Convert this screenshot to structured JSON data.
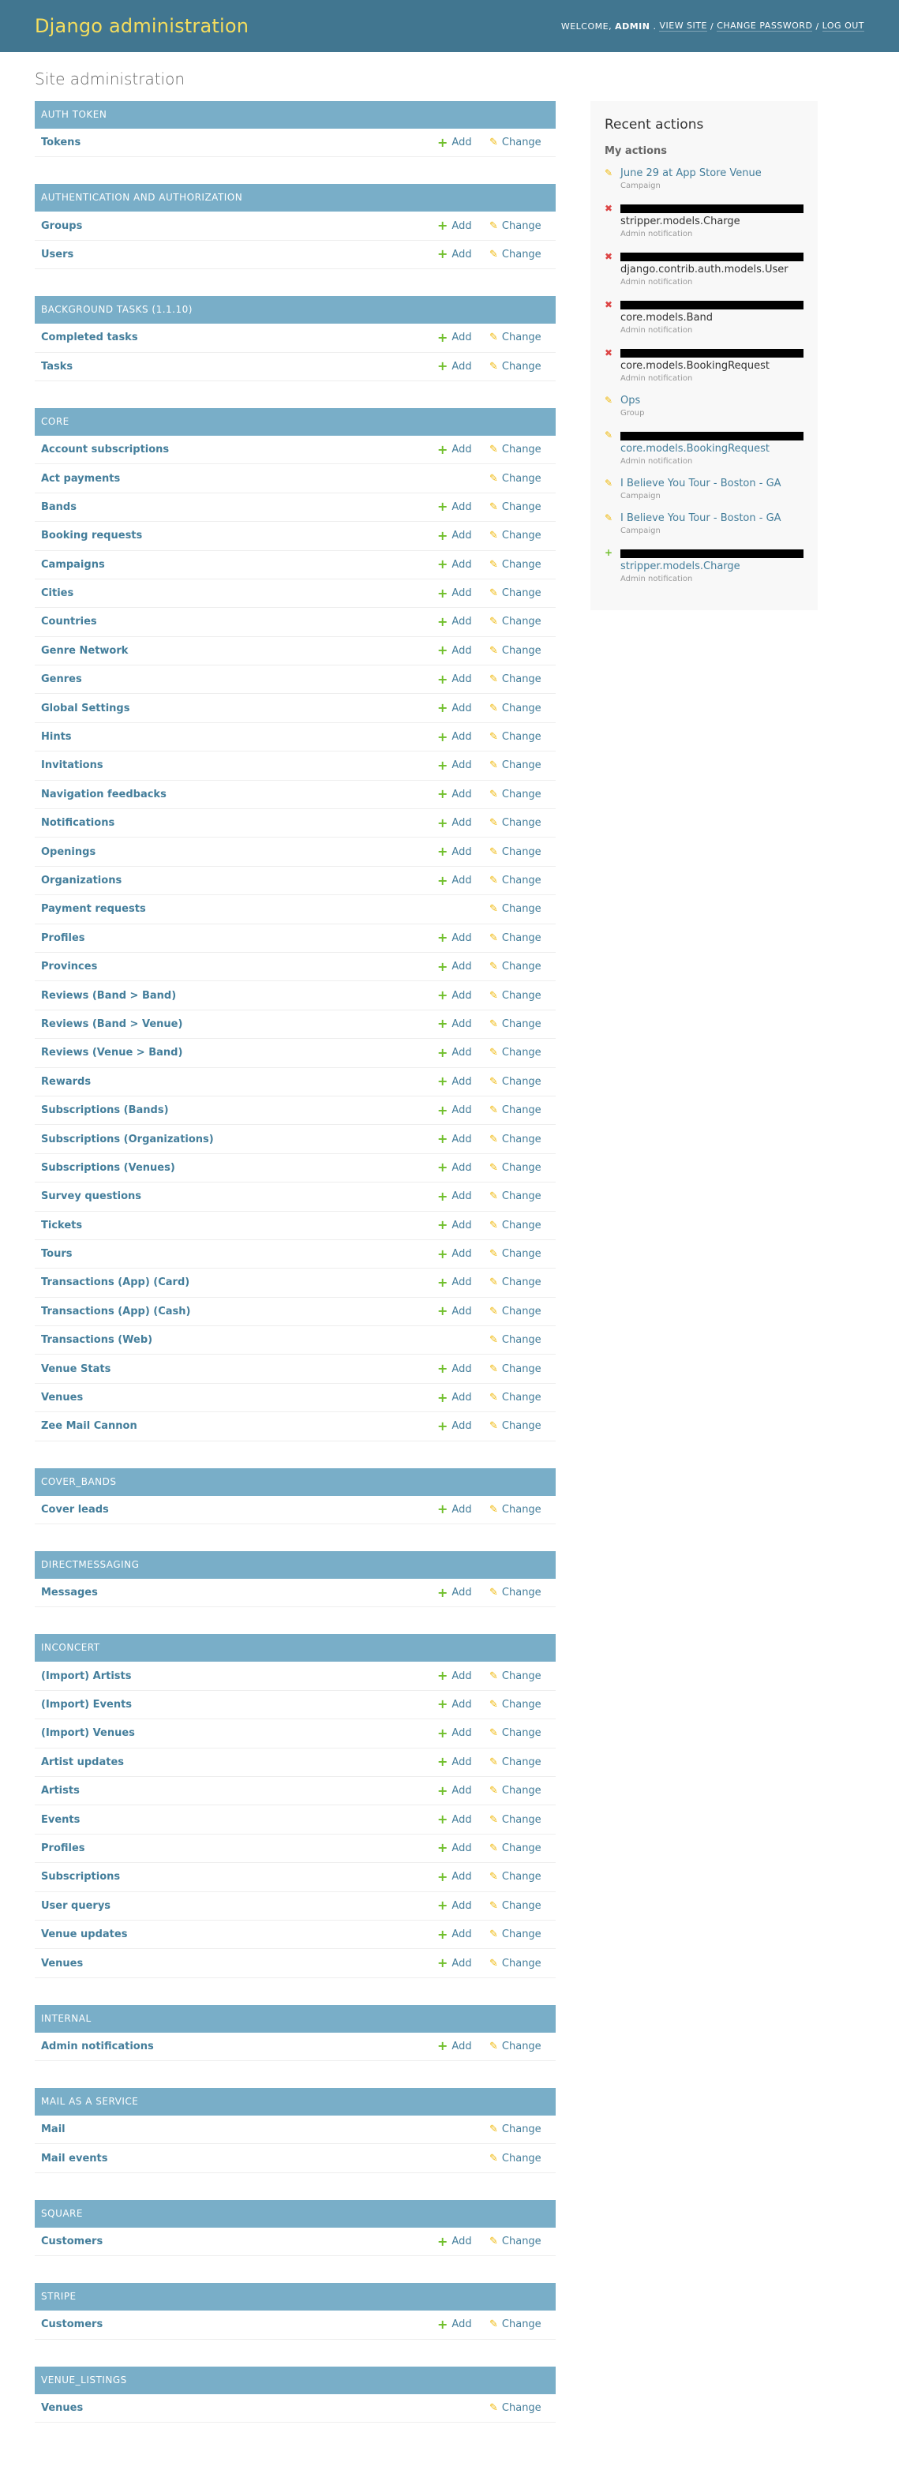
{
  "header": {
    "site_name": "Django administration",
    "welcome": "WELCOME,",
    "username": "ADMIN",
    "view_site": "VIEW SITE",
    "change_password": "CHANGE PASSWORD",
    "log_out": "LOG OUT",
    "separator": "/"
  },
  "page": {
    "title": "Site administration"
  },
  "labels": {
    "add": "Add",
    "change": "Change"
  },
  "apps": [
    {
      "name": "AUTH TOKEN",
      "models": [
        {
          "name": "Tokens",
          "add": true
        }
      ]
    },
    {
      "name": "AUTHENTICATION AND AUTHORIZATION",
      "models": [
        {
          "name": "Groups",
          "add": true
        },
        {
          "name": "Users",
          "add": true
        }
      ]
    },
    {
      "name": "BACKGROUND TASKS (1.1.10)",
      "models": [
        {
          "name": "Completed tasks",
          "add": true
        },
        {
          "name": "Tasks",
          "add": true
        }
      ]
    },
    {
      "name": "CORE",
      "models": [
        {
          "name": "Account subscriptions",
          "add": true
        },
        {
          "name": "Act payments",
          "add": false
        },
        {
          "name": "Bands",
          "add": true
        },
        {
          "name": "Booking requests",
          "add": true
        },
        {
          "name": "Campaigns",
          "add": true
        },
        {
          "name": "Cities",
          "add": true
        },
        {
          "name": "Countries",
          "add": true
        },
        {
          "name": "Genre Network",
          "add": true
        },
        {
          "name": "Genres",
          "add": true
        },
        {
          "name": "Global Settings",
          "add": true
        },
        {
          "name": "Hints",
          "add": true
        },
        {
          "name": "Invitations",
          "add": true
        },
        {
          "name": "Navigation feedbacks",
          "add": true
        },
        {
          "name": "Notifications",
          "add": true
        },
        {
          "name": "Openings",
          "add": true
        },
        {
          "name": "Organizations",
          "add": true
        },
        {
          "name": "Payment requests",
          "add": false
        },
        {
          "name": "Profiles",
          "add": true
        },
        {
          "name": "Provinces",
          "add": true
        },
        {
          "name": "Reviews (Band > Band)",
          "add": true
        },
        {
          "name": "Reviews (Band > Venue)",
          "add": true
        },
        {
          "name": "Reviews (Venue > Band)",
          "add": true
        },
        {
          "name": "Rewards",
          "add": true
        },
        {
          "name": "Subscriptions (Bands)",
          "add": true
        },
        {
          "name": "Subscriptions (Organizations)",
          "add": true
        },
        {
          "name": "Subscriptions (Venues)",
          "add": true
        },
        {
          "name": "Survey questions",
          "add": true
        },
        {
          "name": "Tickets",
          "add": true
        },
        {
          "name": "Tours",
          "add": true
        },
        {
          "name": "Transactions (App) (Card)",
          "add": true
        },
        {
          "name": "Transactions (App) (Cash)",
          "add": true
        },
        {
          "name": "Transactions (Web)",
          "add": false
        },
        {
          "name": "Venue Stats",
          "add": true
        },
        {
          "name": "Venues",
          "add": true
        },
        {
          "name": "Zee Mail Cannon",
          "add": true
        }
      ]
    },
    {
      "name": "COVER_BANDS",
      "models": [
        {
          "name": "Cover leads",
          "add": true
        }
      ]
    },
    {
      "name": "DIRECTMESSAGING",
      "models": [
        {
          "name": "Messages",
          "add": true
        }
      ]
    },
    {
      "name": "INCONCERT",
      "models": [
        {
          "name": "(Import) Artists",
          "add": true
        },
        {
          "name": "(Import) Events",
          "add": true
        },
        {
          "name": "(Import) Venues",
          "add": true
        },
        {
          "name": "Artist updates",
          "add": true
        },
        {
          "name": "Artists",
          "add": true
        },
        {
          "name": "Events",
          "add": true
        },
        {
          "name": "Profiles",
          "add": true
        },
        {
          "name": "Subscriptions",
          "add": true
        },
        {
          "name": "User querys",
          "add": true
        },
        {
          "name": "Venue updates",
          "add": true
        },
        {
          "name": "Venues",
          "add": true
        }
      ]
    },
    {
      "name": "INTERNAL",
      "models": [
        {
          "name": "Admin notifications",
          "add": true
        }
      ]
    },
    {
      "name": "MAIL AS A SERVICE",
      "models": [
        {
          "name": "Mail",
          "add": false
        },
        {
          "name": "Mail events",
          "add": false
        }
      ]
    },
    {
      "name": "SQUARE",
      "models": [
        {
          "name": "Customers",
          "add": true
        }
      ]
    },
    {
      "name": "STRIPE",
      "models": [
        {
          "name": "Customers",
          "add": true
        }
      ]
    },
    {
      "name": "VENUE_LISTINGS",
      "models": [
        {
          "name": "Venues",
          "add": false
        }
      ]
    }
  ],
  "recent_actions": {
    "title": "Recent actions",
    "subtitle": "My actions",
    "items": [
      {
        "action": "change",
        "title": "June 29 at App Store Venue",
        "redacted": false,
        "linked": true,
        "type": "Campaign"
      },
      {
        "action": "delete",
        "title": "stripper.models.Charge",
        "redacted": true,
        "linked": false,
        "type": "Admin notification"
      },
      {
        "action": "delete",
        "title": "django.contrib.auth.models.User",
        "redacted": true,
        "linked": false,
        "type": "Admin notification"
      },
      {
        "action": "delete",
        "title": "core.models.Band",
        "redacted": true,
        "linked": false,
        "type": "Admin notification"
      },
      {
        "action": "delete",
        "title": "core.models.BookingRequest",
        "redacted": true,
        "linked": false,
        "type": "Admin notification"
      },
      {
        "action": "change",
        "title": "Ops",
        "redacted": false,
        "linked": true,
        "type": "Group"
      },
      {
        "action": "change",
        "title": "core.models.BookingRequest",
        "redacted": true,
        "linked": true,
        "type": "Admin notification"
      },
      {
        "action": "change",
        "title": "I Believe You Tour - Boston - GA",
        "redacted": false,
        "linked": true,
        "type": "Campaign"
      },
      {
        "action": "change",
        "title": "I Believe You Tour - Boston - GA",
        "redacted": false,
        "linked": true,
        "type": "Campaign"
      },
      {
        "action": "add",
        "title": "stripper.models.Charge",
        "redacted": true,
        "linked": true,
        "type": "Admin notification"
      }
    ]
  }
}
